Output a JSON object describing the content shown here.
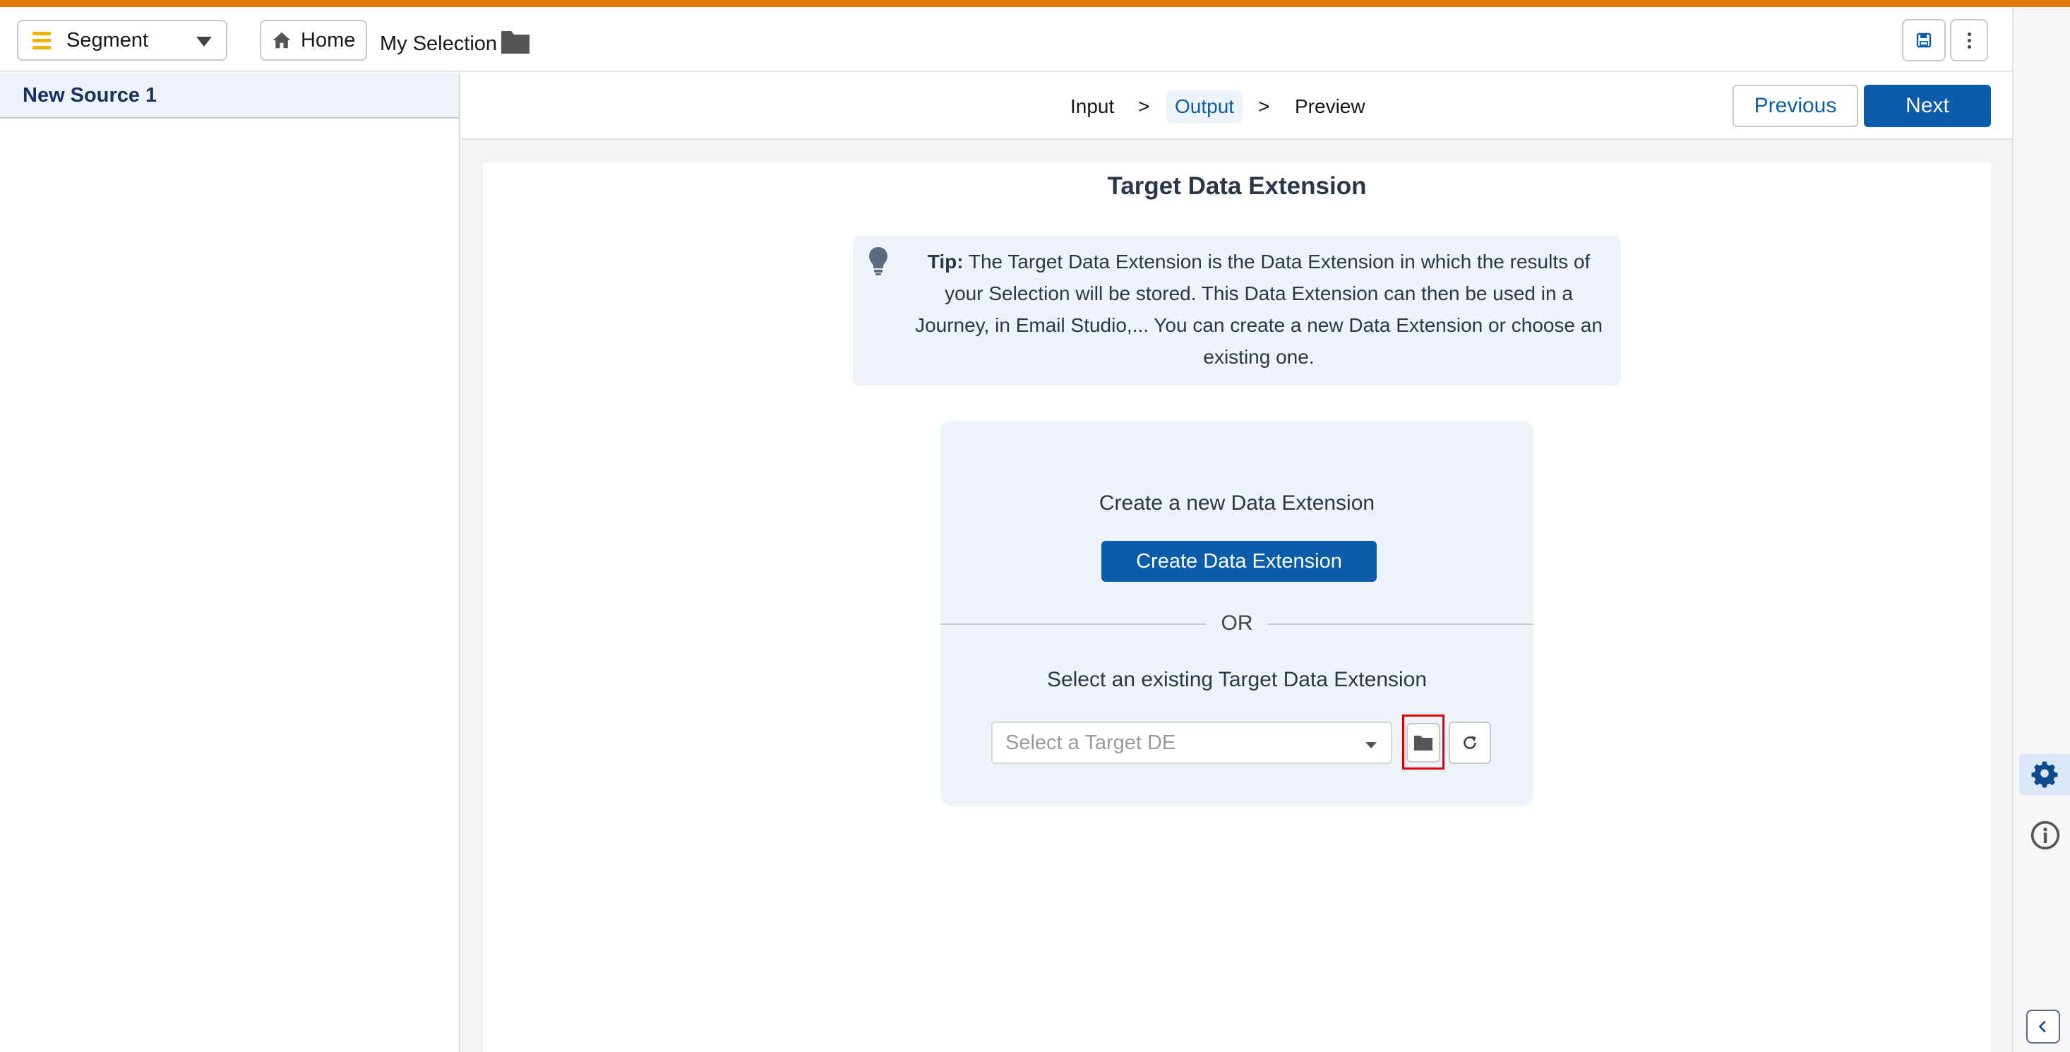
{
  "header": {
    "segment_label": "Segment",
    "home_label": "Home",
    "breadcrumb": "My Selection"
  },
  "left_panel": {
    "source_tab": "New Source 1"
  },
  "steps": {
    "input": "Input",
    "separator": ">",
    "output": "Output",
    "preview": "Preview",
    "active": "Output"
  },
  "nav": {
    "previous": "Previous",
    "next": "Next"
  },
  "main": {
    "title": "Target Data Extension",
    "tip_label": "Tip:",
    "tip_text": " The Target Data Extension is the Data Extension in which the results of your Selection will be stored. This Data Extension can then be used in a Journey, in Email Studio,... You can create a new Data Extension or choose an existing one.",
    "create_label": "Create a new Data Extension",
    "create_button": "Create Data Extension",
    "or": "OR",
    "select_label": "Select an existing Target Data Extension",
    "select_placeholder": "Select a Target DE"
  },
  "colors": {
    "accent": "#e07a10",
    "brand_blue": "#0b5cab",
    "highlight_red": "#e00000",
    "segment_icon": "#f3b200"
  },
  "icons": [
    "menu-bars-icon",
    "chevron-down-icon",
    "home-icon",
    "folder-icon",
    "save-icon",
    "more-vertical-icon",
    "lightbulb-icon",
    "refresh-icon",
    "gear-icon",
    "info-icon",
    "chevron-left-icon"
  ]
}
